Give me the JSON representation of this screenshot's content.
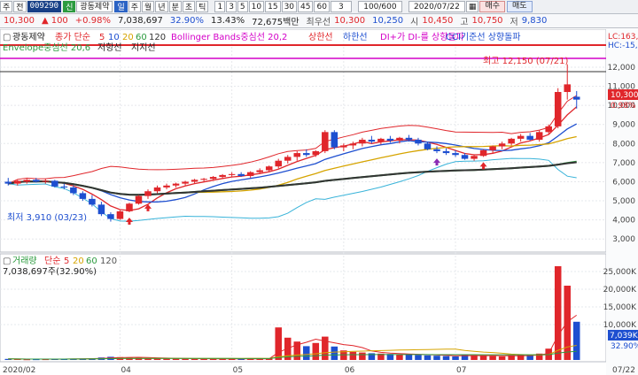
{
  "toolbar": {
    "prefix": "주",
    "prefix2": "전",
    "code": "009290",
    "name_badge": "신",
    "name": "광동제약",
    "periods": [
      "일",
      "주",
      "월",
      "년",
      "분",
      "초",
      "틱"
    ],
    "intervals": [
      "1",
      "3",
      "5",
      "10",
      "15",
      "30",
      "45",
      "60"
    ],
    "count_value": "3",
    "range": "100/600",
    "date": "2020/07/22",
    "buy": "매수",
    "sell": "매도"
  },
  "quote": {
    "price": "10,300",
    "change_arrow": "▲",
    "change": "100",
    "change_pct": "+0.98%",
    "volume": "7,038,697",
    "ratio1": "32.90%",
    "ratio2": "13.43%",
    "amount": "72,675백만",
    "open_label": "최우선",
    "open_value": "10,300",
    "bid": "10,250",
    "ask_label": "시",
    "ask_value": "10,450",
    "high_label": "고",
    "high_value": "10,750",
    "low_label": "저",
    "low_value": "9,830"
  },
  "legend_price": {
    "stock": "광동제약",
    "ma_label": "종가 단순",
    "ma_periods": [
      "5",
      "10",
      "20",
      "60",
      "120"
    ],
    "bb": "Bollinger Bands중심선 20,2",
    "bb_upper": "상한선",
    "bb_lower": "하한선",
    "dmi": "DI+가 DI-를 상향돌파",
    "cci": "CCI기준선 상향돌파",
    "envelope": "Envelope중심선 20,6",
    "envelope2": "저항선",
    "envelope3": "지지선"
  },
  "legend_volume": {
    "label": "거래량",
    "ma_label": "단순",
    "ma_periods": [
      "5",
      "20",
      "60",
      "120"
    ],
    "current": "7,038,697주(32.90%)"
  },
  "colors": {
    "up": "#e0262b",
    "down": "#1e4fd0",
    "ma5": "#e0262b",
    "ma10": "#1e4fd0",
    "ma20": "#d6a400",
    "ma60": "#2c9b3f",
    "ma120": "#333333",
    "magenta": "#d400c8"
  },
  "chart_data": {
    "type": "candlestick",
    "dates": [
      "2020/02",
      "04",
      "05",
      "06",
      "07",
      "07/22"
    ],
    "price_axis": [
      "12,000",
      "11,000",
      "10,000",
      "9,000",
      "8,000",
      "7,000",
      "6,000",
      "5,000",
      "4,000",
      "3,000"
    ],
    "price_ylim": [
      2500,
      12600
    ],
    "price_labels": {
      "lc": "LC:163,4",
      "hc": "HC:-15,",
      "current": "10,300",
      "pct": "0.98%",
      "high_label": "최고 12,150 (07/21)",
      "low_label": "최저 3,910 (03/23)"
    },
    "volume_axis": [
      "25,000K",
      "20,000K",
      "15,000K",
      "10,000K"
    ],
    "volume_ylim": [
      0,
      28000
    ],
    "volume_labels": {
      "current": "7,039K",
      "pct": "32.90%"
    },
    "candles": [
      {
        "o": 6000,
        "h": 6200,
        "l": 5800,
        "c": 5900
      },
      {
        "o": 5900,
        "h": 6100,
        "l": 5800,
        "c": 6050
      },
      {
        "o": 6000,
        "h": 6150,
        "l": 5900,
        "c": 6100
      },
      {
        "o": 6100,
        "h": 6200,
        "l": 5950,
        "c": 6000
      },
      {
        "o": 6000,
        "h": 6150,
        "l": 5900,
        "c": 6050
      },
      {
        "o": 6050,
        "h": 6100,
        "l": 5700,
        "c": 5750
      },
      {
        "o": 5750,
        "h": 5900,
        "l": 5600,
        "c": 5700
      },
      {
        "o": 5700,
        "h": 5800,
        "l": 5300,
        "c": 5400
      },
      {
        "o": 5400,
        "h": 5500,
        "l": 5000,
        "c": 5100
      },
      {
        "o": 5100,
        "h": 5300,
        "l": 4700,
        "c": 4800
      },
      {
        "o": 4800,
        "h": 4950,
        "l": 4200,
        "c": 4300
      },
      {
        "o": 4300,
        "h": 4400,
        "l": 3910,
        "c": 4050
      },
      {
        "o": 4050,
        "h": 4500,
        "l": 4000,
        "c": 4450
      },
      {
        "o": 4450,
        "h": 4900,
        "l": 4400,
        "c": 4850
      },
      {
        "o": 4850,
        "h": 5300,
        "l": 4800,
        "c": 5250
      },
      {
        "o": 5250,
        "h": 5600,
        "l": 5100,
        "c": 5500
      },
      {
        "o": 5500,
        "h": 5800,
        "l": 5400,
        "c": 5700
      },
      {
        "o": 5700,
        "h": 5900,
        "l": 5600,
        "c": 5800
      },
      {
        "o": 5800,
        "h": 5950,
        "l": 5700,
        "c": 5900
      },
      {
        "o": 5900,
        "h": 6050,
        "l": 5800,
        "c": 6000
      },
      {
        "o": 6000,
        "h": 6150,
        "l": 5900,
        "c": 6100
      },
      {
        "o": 6100,
        "h": 6200,
        "l": 6000,
        "c": 6150
      },
      {
        "o": 6150,
        "h": 6300,
        "l": 6050,
        "c": 6250
      },
      {
        "o": 6250,
        "h": 6400,
        "l": 6150,
        "c": 6350
      },
      {
        "o": 6350,
        "h": 6500,
        "l": 6250,
        "c": 6400
      },
      {
        "o": 6400,
        "h": 6500,
        "l": 6250,
        "c": 6300
      },
      {
        "o": 6300,
        "h": 6550,
        "l": 6200,
        "c": 6500
      },
      {
        "o": 6500,
        "h": 6700,
        "l": 6400,
        "c": 6600
      },
      {
        "o": 6600,
        "h": 6850,
        "l": 6500,
        "c": 6800
      },
      {
        "o": 6800,
        "h": 7200,
        "l": 6700,
        "c": 7100
      },
      {
        "o": 7100,
        "h": 7400,
        "l": 6950,
        "c": 7300
      },
      {
        "o": 7300,
        "h": 7600,
        "l": 7100,
        "c": 7500
      },
      {
        "o": 7500,
        "h": 7700,
        "l": 7300,
        "c": 7400
      },
      {
        "o": 7400,
        "h": 7650,
        "l": 7300,
        "c": 7600
      },
      {
        "o": 7600,
        "h": 8700,
        "l": 7500,
        "c": 8600
      },
      {
        "o": 8600,
        "h": 8700,
        "l": 7700,
        "c": 7800
      },
      {
        "o": 7800,
        "h": 8000,
        "l": 7600,
        "c": 7900
      },
      {
        "o": 7900,
        "h": 8100,
        "l": 7700,
        "c": 8000
      },
      {
        "o": 8000,
        "h": 8300,
        "l": 7850,
        "c": 8200
      },
      {
        "o": 8200,
        "h": 8400,
        "l": 8000,
        "c": 8100
      },
      {
        "o": 8100,
        "h": 8300,
        "l": 7950,
        "c": 8250
      },
      {
        "o": 8250,
        "h": 8400,
        "l": 8050,
        "c": 8150
      },
      {
        "o": 8150,
        "h": 8350,
        "l": 8000,
        "c": 8300
      },
      {
        "o": 8300,
        "h": 8450,
        "l": 8100,
        "c": 8200
      },
      {
        "o": 8200,
        "h": 8300,
        "l": 7900,
        "c": 8000
      },
      {
        "o": 8000,
        "h": 8100,
        "l": 7650,
        "c": 7700
      },
      {
        "o": 7700,
        "h": 7850,
        "l": 7500,
        "c": 7600
      },
      {
        "o": 7600,
        "h": 7750,
        "l": 7400,
        "c": 7500
      },
      {
        "o": 7500,
        "h": 7650,
        "l": 7300,
        "c": 7400
      },
      {
        "o": 7400,
        "h": 7500,
        "l": 7150,
        "c": 7200
      },
      {
        "o": 7200,
        "h": 7400,
        "l": 7100,
        "c": 7350
      },
      {
        "o": 7350,
        "h": 7700,
        "l": 7300,
        "c": 7650
      },
      {
        "o": 7650,
        "h": 7900,
        "l": 7500,
        "c": 7850
      },
      {
        "o": 7850,
        "h": 8100,
        "l": 7700,
        "c": 8000
      },
      {
        "o": 8000,
        "h": 8300,
        "l": 7900,
        "c": 8250
      },
      {
        "o": 8250,
        "h": 8500,
        "l": 8100,
        "c": 8400
      },
      {
        "o": 8400,
        "h": 8550,
        "l": 8150,
        "c": 8200
      },
      {
        "o": 8200,
        "h": 8700,
        "l": 8100,
        "c": 8600
      },
      {
        "o": 8600,
        "h": 9000,
        "l": 8500,
        "c": 8900
      },
      {
        "o": 8900,
        "h": 10900,
        "l": 8800,
        "c": 10700
      },
      {
        "o": 10700,
        "h": 12150,
        "l": 10300,
        "c": 11100
      },
      {
        "o": 10450,
        "h": 10750,
        "l": 9830,
        "c": 10300
      }
    ],
    "volumes": [
      300,
      250,
      200,
      220,
      230,
      280,
      300,
      350,
      400,
      500,
      700,
      900,
      800,
      700,
      600,
      500,
      450,
      400,
      380,
      360,
      340,
      330,
      320,
      300,
      310,
      300,
      320,
      350,
      380,
      9200,
      6300,
      5200,
      3900,
      4800,
      6600,
      3800,
      2700,
      2300,
      2100,
      1900,
      1800,
      1700,
      1600,
      1500,
      1400,
      1300,
      1200,
      1100,
      1000,
      1500,
      1300,
      1200,
      1100,
      1000,
      1300,
      1400,
      1500,
      1800,
      3200,
      26500,
      21000,
      10800
    ],
    "series": [
      {
        "name": "5",
        "color": "#e0262b"
      },
      {
        "name": "10",
        "color": "#1e4fd0"
      },
      {
        "name": "20",
        "color": "#d6a400"
      },
      {
        "name": "60",
        "color": "#2c9b3f"
      },
      {
        "name": "120",
        "color": "#333333"
      }
    ]
  }
}
